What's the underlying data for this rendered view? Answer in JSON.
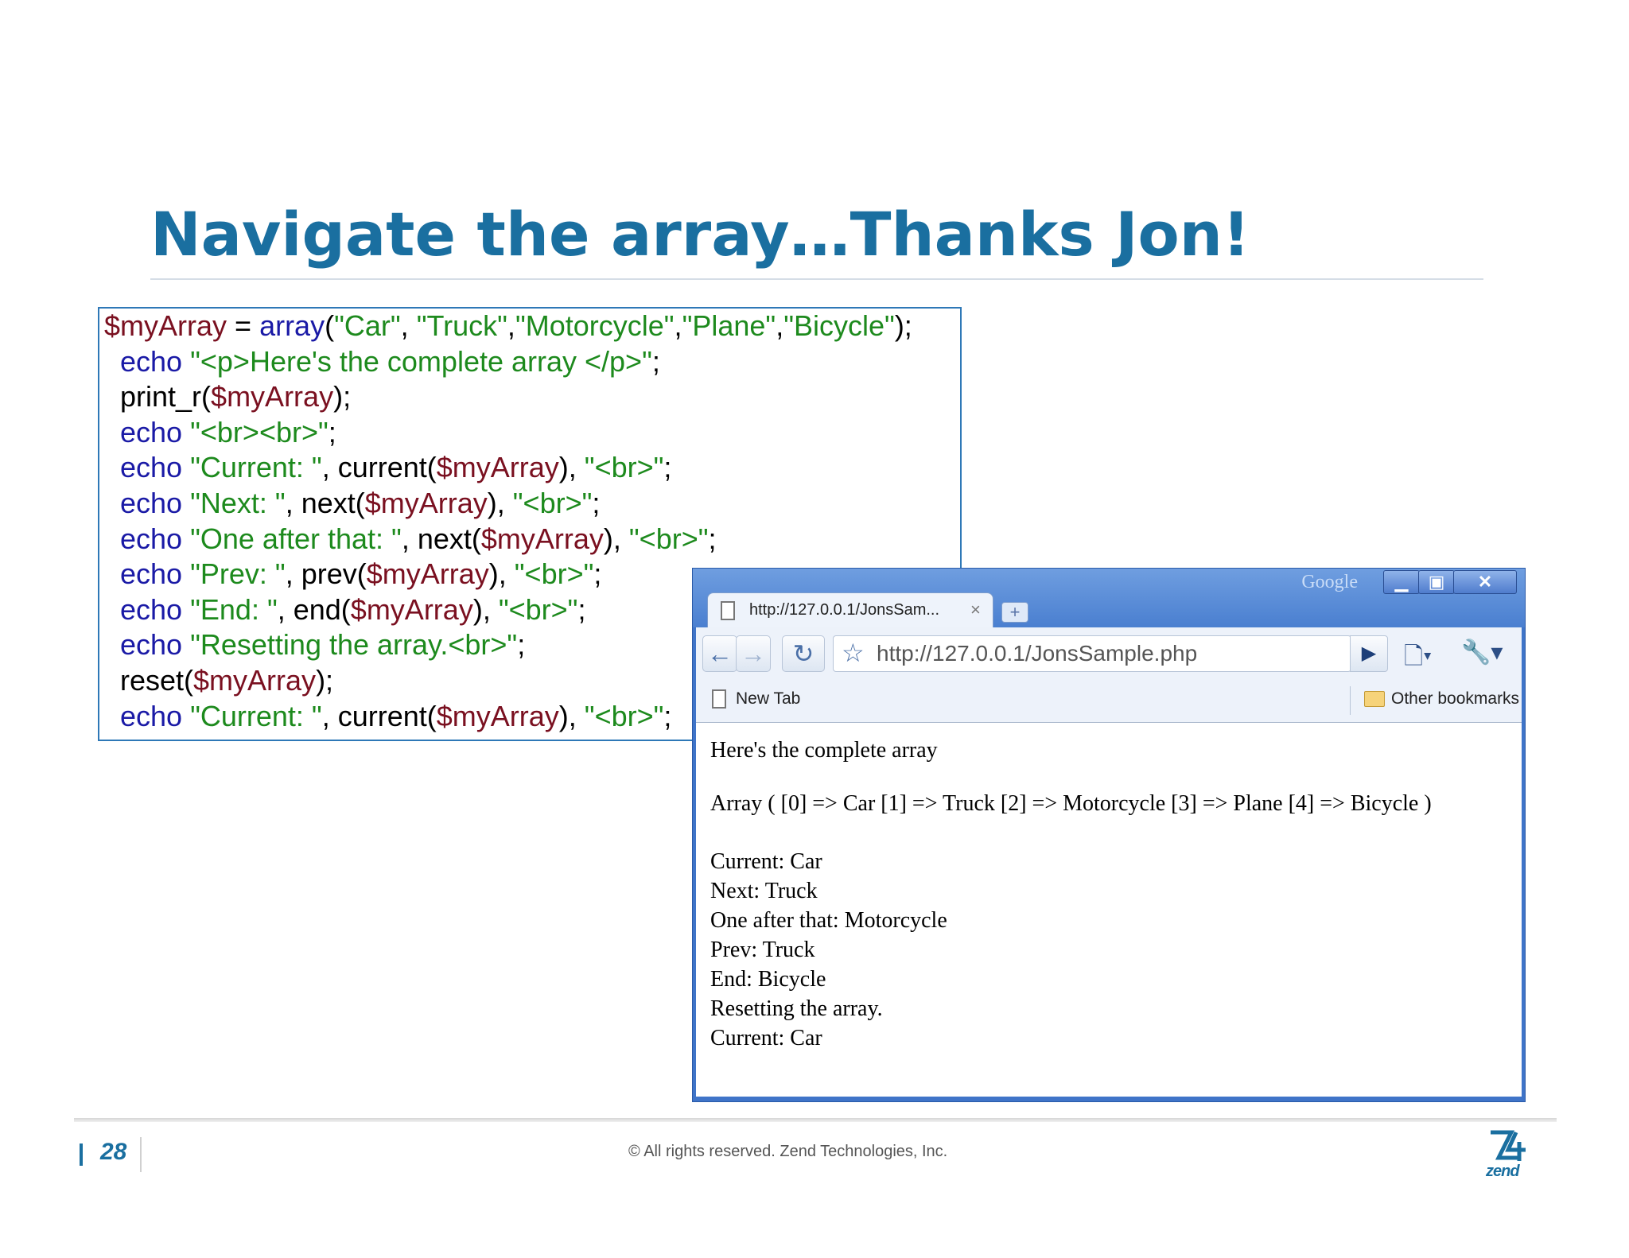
{
  "slide": {
    "title": "Navigate the array…Thanks Jon!",
    "page_number": "28",
    "copyright": "© All rights reserved. Zend Technologies, Inc.",
    "logo_text": "zend"
  },
  "code": {
    "lines": [
      [
        [
          "var",
          "$myArray"
        ],
        [
          "fn",
          " = "
        ],
        [
          "blue",
          "array"
        ],
        [
          "fn",
          "("
        ],
        [
          "str",
          "\"Car\""
        ],
        [
          "fn",
          ", "
        ],
        [
          "str",
          "\"Truck\""
        ],
        [
          "fn",
          ","
        ],
        [
          "str",
          "\"Motorcycle\""
        ],
        [
          "fn",
          ","
        ],
        [
          "str",
          "\"Plane\""
        ],
        [
          "fn",
          ","
        ],
        [
          "str",
          "\"Bicycle\""
        ],
        [
          "fn",
          ");"
        ]
      ],
      [
        [
          "fn",
          "  "
        ],
        [
          "kw",
          "echo"
        ],
        [
          "fn",
          " "
        ],
        [
          "str",
          "\"<p>Here's the complete array </p>\""
        ],
        [
          "fn",
          ";"
        ]
      ],
      [
        [
          "fn",
          "  print_r("
        ],
        [
          "var",
          "$myArray"
        ],
        [
          "fn",
          ");"
        ]
      ],
      [
        [
          "fn",
          "  "
        ],
        [
          "kw",
          "echo"
        ],
        [
          "fn",
          " "
        ],
        [
          "str",
          "\"<br><br>\""
        ],
        [
          "fn",
          ";"
        ]
      ],
      [
        [
          "fn",
          "  "
        ],
        [
          "kw",
          "echo"
        ],
        [
          "fn",
          " "
        ],
        [
          "str",
          "\"Current: \""
        ],
        [
          "fn",
          ", current("
        ],
        [
          "var",
          "$myArray"
        ],
        [
          "fn",
          "), "
        ],
        [
          "str",
          "\"<br>\""
        ],
        [
          "fn",
          ";"
        ]
      ],
      [
        [
          "fn",
          "  "
        ],
        [
          "kw",
          "echo"
        ],
        [
          "fn",
          " "
        ],
        [
          "str",
          "\"Next: \""
        ],
        [
          "fn",
          ", next("
        ],
        [
          "var",
          "$myArray"
        ],
        [
          "fn",
          "), "
        ],
        [
          "str",
          "\"<br>\""
        ],
        [
          "fn",
          ";"
        ]
      ],
      [
        [
          "fn",
          "  "
        ],
        [
          "kw",
          "echo"
        ],
        [
          "fn",
          " "
        ],
        [
          "str",
          "\"One after that: \""
        ],
        [
          "fn",
          ", next("
        ],
        [
          "var",
          "$myArray"
        ],
        [
          "fn",
          "), "
        ],
        [
          "str",
          "\"<br>\""
        ],
        [
          "fn",
          ";"
        ]
      ],
      [
        [
          "fn",
          "  "
        ],
        [
          "kw",
          "echo"
        ],
        [
          "fn",
          " "
        ],
        [
          "str",
          "\"Prev: \""
        ],
        [
          "fn",
          ", prev("
        ],
        [
          "var",
          "$myArray"
        ],
        [
          "fn",
          "), "
        ],
        [
          "str",
          "\"<br>\""
        ],
        [
          "fn",
          ";"
        ]
      ],
      [
        [
          "fn",
          "  "
        ],
        [
          "kw",
          "echo"
        ],
        [
          "fn",
          " "
        ],
        [
          "str",
          "\"End: \""
        ],
        [
          "fn",
          ", end("
        ],
        [
          "var",
          "$myArray"
        ],
        [
          "fn",
          "), "
        ],
        [
          "str",
          "\"<br>\""
        ],
        [
          "fn",
          ";"
        ]
      ],
      [
        [
          "fn",
          "  "
        ],
        [
          "kw",
          "echo"
        ],
        [
          "fn",
          " "
        ],
        [
          "str",
          "\"Resetting the array.<br>\""
        ],
        [
          "fn",
          ";"
        ]
      ],
      [
        [
          "fn",
          "  reset("
        ],
        [
          "var",
          "$myArray"
        ],
        [
          "fn",
          ");"
        ]
      ],
      [
        [
          "fn",
          "  "
        ],
        [
          "kw",
          "echo"
        ],
        [
          "fn",
          " "
        ],
        [
          "str",
          "\"Current: \""
        ],
        [
          "fn",
          ", current("
        ],
        [
          "var",
          "$myArray"
        ],
        [
          "fn",
          "), "
        ],
        [
          "str",
          "\"<br>\""
        ],
        [
          "fn",
          ";"
        ]
      ]
    ]
  },
  "browser": {
    "titlebar_brand": "Google",
    "tab_title": "http://127.0.0.1/JonsSam...",
    "tab_close": "×",
    "new_tab_button": "+",
    "url": "http://127.0.0.1/JonsSample.php",
    "bookmarks": {
      "left": "New Tab",
      "right": "Other bookmarks"
    },
    "content": {
      "heading": "Here's the complete array",
      "array_dump": "Array ( [0] => Car [1] => Truck [2] => Motorcycle [3] => Plane [4] => Bicycle )",
      "output_lines": [
        "Current: Car",
        "Next: Truck",
        "One after that: Motorcycle",
        "Prev: Truck",
        "End: Bicycle",
        "Resetting the array.",
        "Current: Car"
      ]
    },
    "icons": {
      "back": "back-arrow-icon",
      "forward": "forward-arrow-icon",
      "reload": "reload-icon",
      "bookmark_star": "star-icon",
      "go": "play-icon",
      "page_menu": "page-menu-icon",
      "tools_menu": "wrench-icon",
      "window_min": "minimize-icon",
      "window_max": "maximize-icon",
      "window_close": "close-icon"
    }
  }
}
